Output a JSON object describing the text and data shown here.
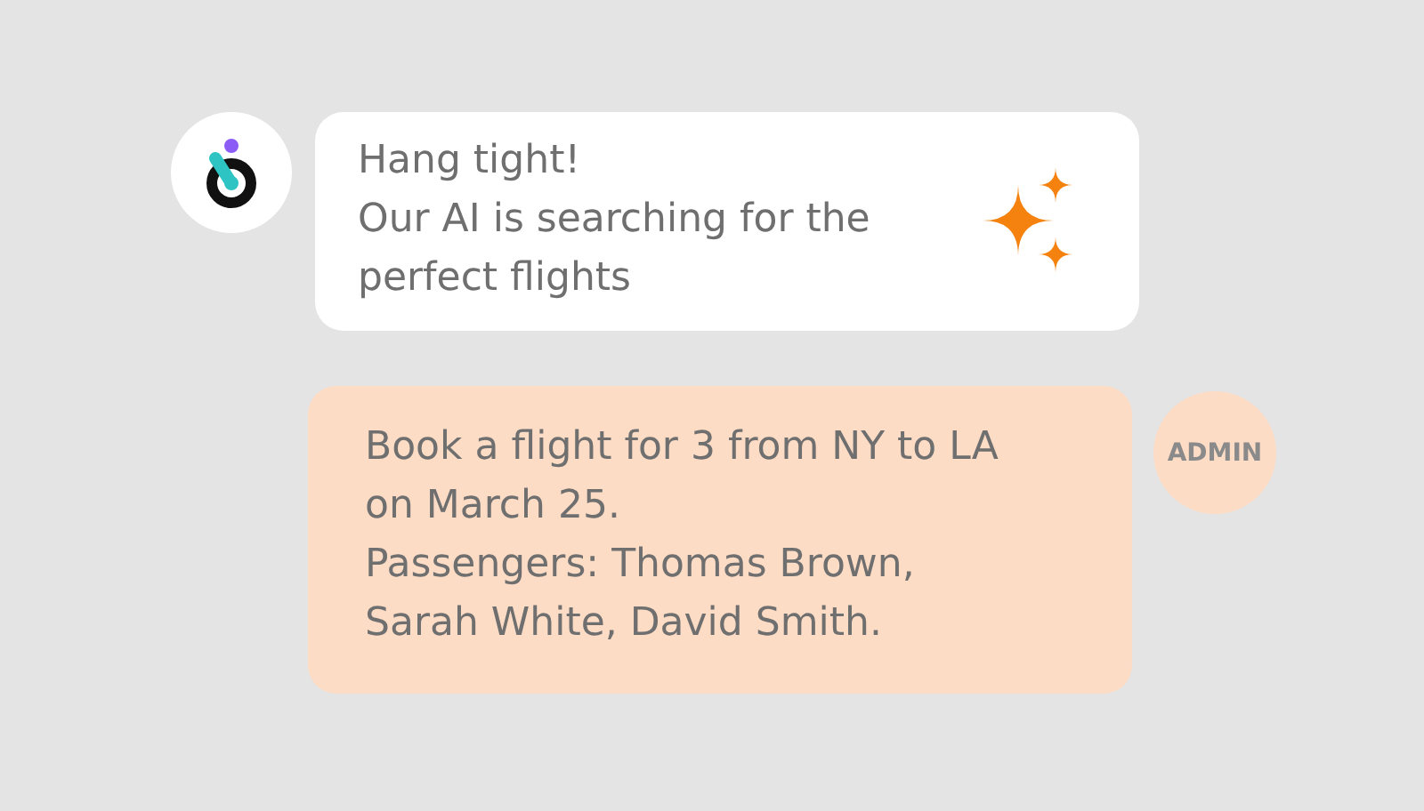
{
  "messages": [
    {
      "kind": "bot",
      "lines": [
        "Hang tight!",
        "Our AI is searching for the",
        "perfect flights"
      ]
    },
    {
      "kind": "user",
      "avatar": "ADMIN",
      "lines": [
        "Book a flight for 3 from NY to LA",
        "on March 25.",
        "Passengers: Thomas Brown,",
        "Sarah White, David Smith."
      ]
    }
  ]
}
